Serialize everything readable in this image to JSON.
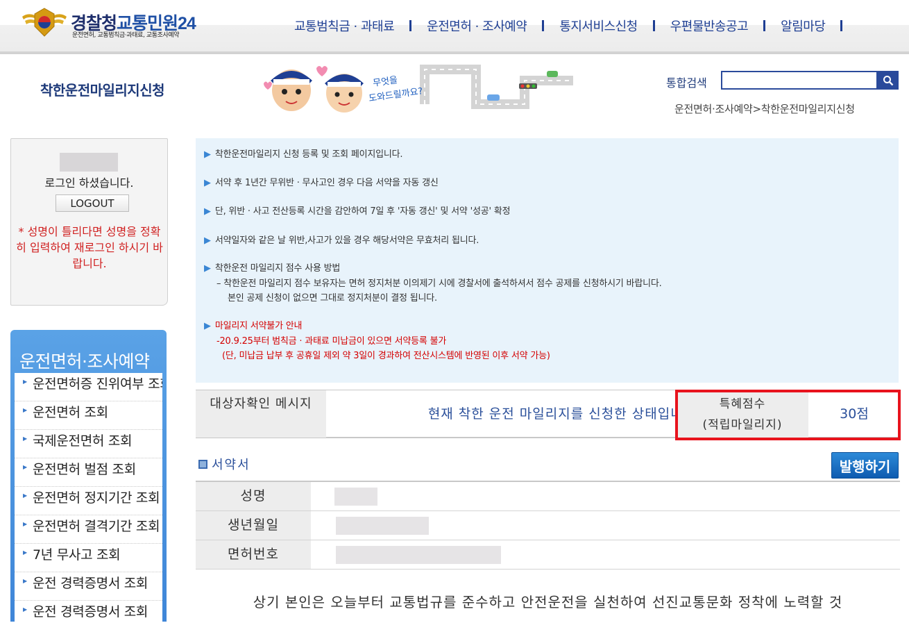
{
  "header": {
    "brand_main": "경찰청",
    "brand_sub": "교통민원24",
    "tagline": "운전면허, 교통범칙금·과태료, 교통조사예약",
    "nav": [
      "교통범칙금 · 과태료",
      "운전면허 · 조사예약",
      "통지서비스신청",
      "우편물반송공고",
      "알림마당"
    ]
  },
  "subheader": {
    "page_title": "착한운전마일리지신청",
    "illustration_text_line1": "무엇을",
    "illustration_text_line2": "도와드릴까요?",
    "search_label": "통합검색",
    "search_value": "",
    "breadcrumb": "운전면허·조사예약>착한운전마일리지신청"
  },
  "login": {
    "message": "로그인 하셨습니다.",
    "logout_label": "LOGOUT",
    "warning": "* 성명이 틀리다면 성명을 정확히 입력하여 재로그인 하시기 바랍니다."
  },
  "left_menu": {
    "title": "운전면허·조사예약",
    "items": [
      "운전면허증 진위여부 조회",
      "운전면허 조회",
      "국제운전면허 조회",
      "운전면허 벌점 조회",
      "운전면허 정지기간 조회",
      "운전면허 결격기간 조회",
      "7년 무사고 조회",
      "운전 경력증명서 조회",
      "운전 경력증명서 조회"
    ]
  },
  "notice": {
    "l1": "착한운전마일리지 신청 등록 및 조회 페이지입니다.",
    "l2": "서약 후 1년간 무위반 · 무사고인 경우 다음 서약을 자동 갱신",
    "l3": "단, 위반 · 사고 전산등록 시간을 감안하여 7일 후 '자동 갱신' 및 서약 '성공' 확정",
    "l4": "서약일자와 같은 날 위반,사고가 있을 경우 해당서약은 무효처리 됩니다.",
    "l5": "착한운전 마일리지 점수 사용 방법",
    "l5a": "– 착한운전 마일리지 점수 보유자는 면허 정지처분 이의제기 시에 경찰서에 출석하셔서 점수 공제를 신청하시기 바랍니다.",
    "l5b": "본인 공제 신청이 없으면 그대로 정지처분이 결정 됩니다.",
    "l6": "마일리지 서약불가 안내",
    "l6a": "-20.9.25부터 범칙금 · 과태료 미납금이 있으면 서약등록 불가",
    "l6b": "(단, 미납금 납부 후 공휴일 제외 약 3일이 경과하여 전산시스템에 반영된 이후 서약 가능)"
  },
  "status": {
    "label": "대상자확인 메시지",
    "message": "현재 착한 운전 마일리지를 신청한 상태입니다.",
    "points_label_1": "특혜점수",
    "points_label_2": "(적립마일리지)",
    "points_value": "30점"
  },
  "contract": {
    "heading": "서약서",
    "issue_button": "발행하기",
    "fields": [
      "성명",
      "생년월일",
      "면허번호"
    ],
    "pledge": "상기 본인은 오늘부터 교통법규를 준수하고 안전운전을 실천하여 선진교통문화 정착에 노력할 것"
  },
  "colors": {
    "accent_blue": "#1f3f93",
    "highlight_red": "#e8131d",
    "notice_bg": "#e8f3fb"
  }
}
